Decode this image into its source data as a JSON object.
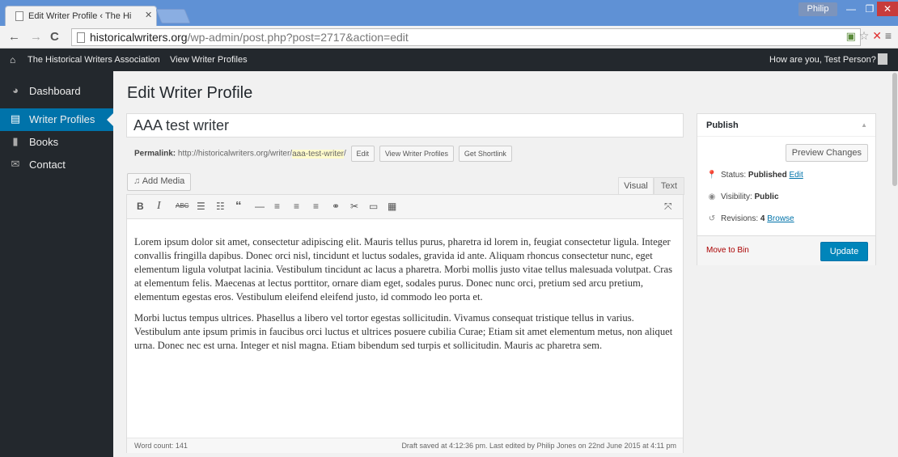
{
  "browser": {
    "tab_title": "Edit Writer Profile ‹ The Hi",
    "user": "Philip",
    "url_host": "historicalwriters.org",
    "url_path": "/wp-admin/post.php?post=2717&action=edit"
  },
  "adminbar": {
    "site_name": "The Historical Writers Association",
    "view_link": "View Writer Profiles",
    "greeting": "How are you, Test Person?"
  },
  "sidebar": {
    "items": [
      {
        "label": "Dashboard",
        "icon": "dashboard-icon"
      },
      {
        "label": "Writer Profiles",
        "icon": "writer-profiles-icon"
      },
      {
        "label": "Books",
        "icon": "books-icon"
      },
      {
        "label": "Contact",
        "icon": "mail-icon"
      }
    ],
    "active_color": "#0073aa"
  },
  "page": {
    "title": "Edit Writer Profile",
    "post_title": "AAA test writer",
    "permalink_label": "Permalink:",
    "permalink_base": "http://historicalwriters.org/writer/",
    "permalink_slug": "aaa-test-writer",
    "permalink_tail": "/",
    "edit_btn": "Edit",
    "view_btn": "View Writer Profiles",
    "shortlink_btn": "Get Shortlink"
  },
  "editor": {
    "add_media": "Add Media",
    "tab_visual": "Visual",
    "tab_text": "Text",
    "paragraph1": "Lorem ipsum dolor sit amet, consectetur adipiscing elit. Mauris tellus purus, pharetra id lorem in, feugiat consectetur ligula. Integer convallis fringilla dapibus. Donec orci nisl, tincidunt et luctus sodales, gravida id ante. Aliquam rhoncus consectetur nunc, eget elementum ligula volutpat lacinia. Vestibulum tincidunt ac lacus a pharetra. Morbi mollis justo vitae tellus malesuada volutpat. Cras at elementum felis. Maecenas at lectus porttitor, ornare diam eget, sodales purus. Donec nunc orci, pretium sed arcu pretium, elementum egestas eros. Vestibulum eleifend eleifend justo, id commodo leo porta et.",
    "paragraph2": "Morbi luctus tempus ultrices. Phasellus a libero vel tortor egestas sollicitudin. Vivamus consequat tristique tellus in varius. Vestibulum ante ipsum primis in faucibus orci luctus et ultrices posuere cubilia Curae; Etiam sit amet elementum metus, non aliquet urna. Donec nec est urna. Integer et nisl magna. Etiam bibendum sed turpis et sollicitudin. Mauris ac pharetra sem.",
    "word_count": "Word count: 141",
    "draft_status": "Draft saved at 4:12:36 pm. Last edited by Philip Jones on 22nd June 2015 at 4:11 pm"
  },
  "publish": {
    "title": "Publish",
    "preview_btn": "Preview Changes",
    "status_label": "Status:",
    "status_value": "Published",
    "status_edit": "Edit",
    "visibility_label": "Visibility:",
    "visibility_value": "Public",
    "revisions_label": "Revisions:",
    "revisions_value": "4",
    "revisions_link": "Browse",
    "move_to_bin": "Move to Bin",
    "update_btn": "Update",
    "update_color": "#0085ba"
  }
}
